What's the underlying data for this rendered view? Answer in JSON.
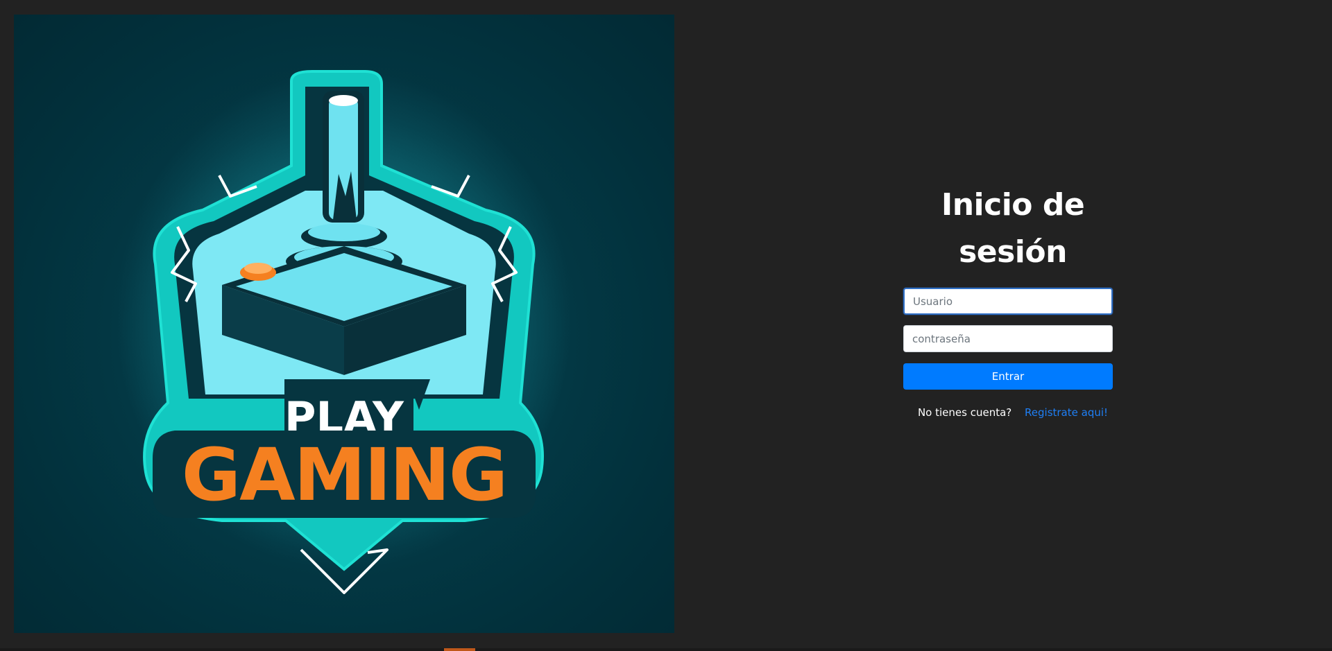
{
  "hero": {
    "logo_line1": "PLAY",
    "logo_line2": "GAMING",
    "icon": "joystick-emblem"
  },
  "login": {
    "title": "Inicio de sesión",
    "username_placeholder": "Usuario",
    "password_placeholder": "contraseña",
    "submit_label": "Entrar",
    "signup_question": "No tienes cuenta?",
    "signup_link": "Registrate aqui!"
  },
  "colors": {
    "background": "#222222",
    "accent": "#007bff",
    "link": "#1f7ff5",
    "logo_cyan": "#18d3c6",
    "logo_orange": "#f58020"
  }
}
